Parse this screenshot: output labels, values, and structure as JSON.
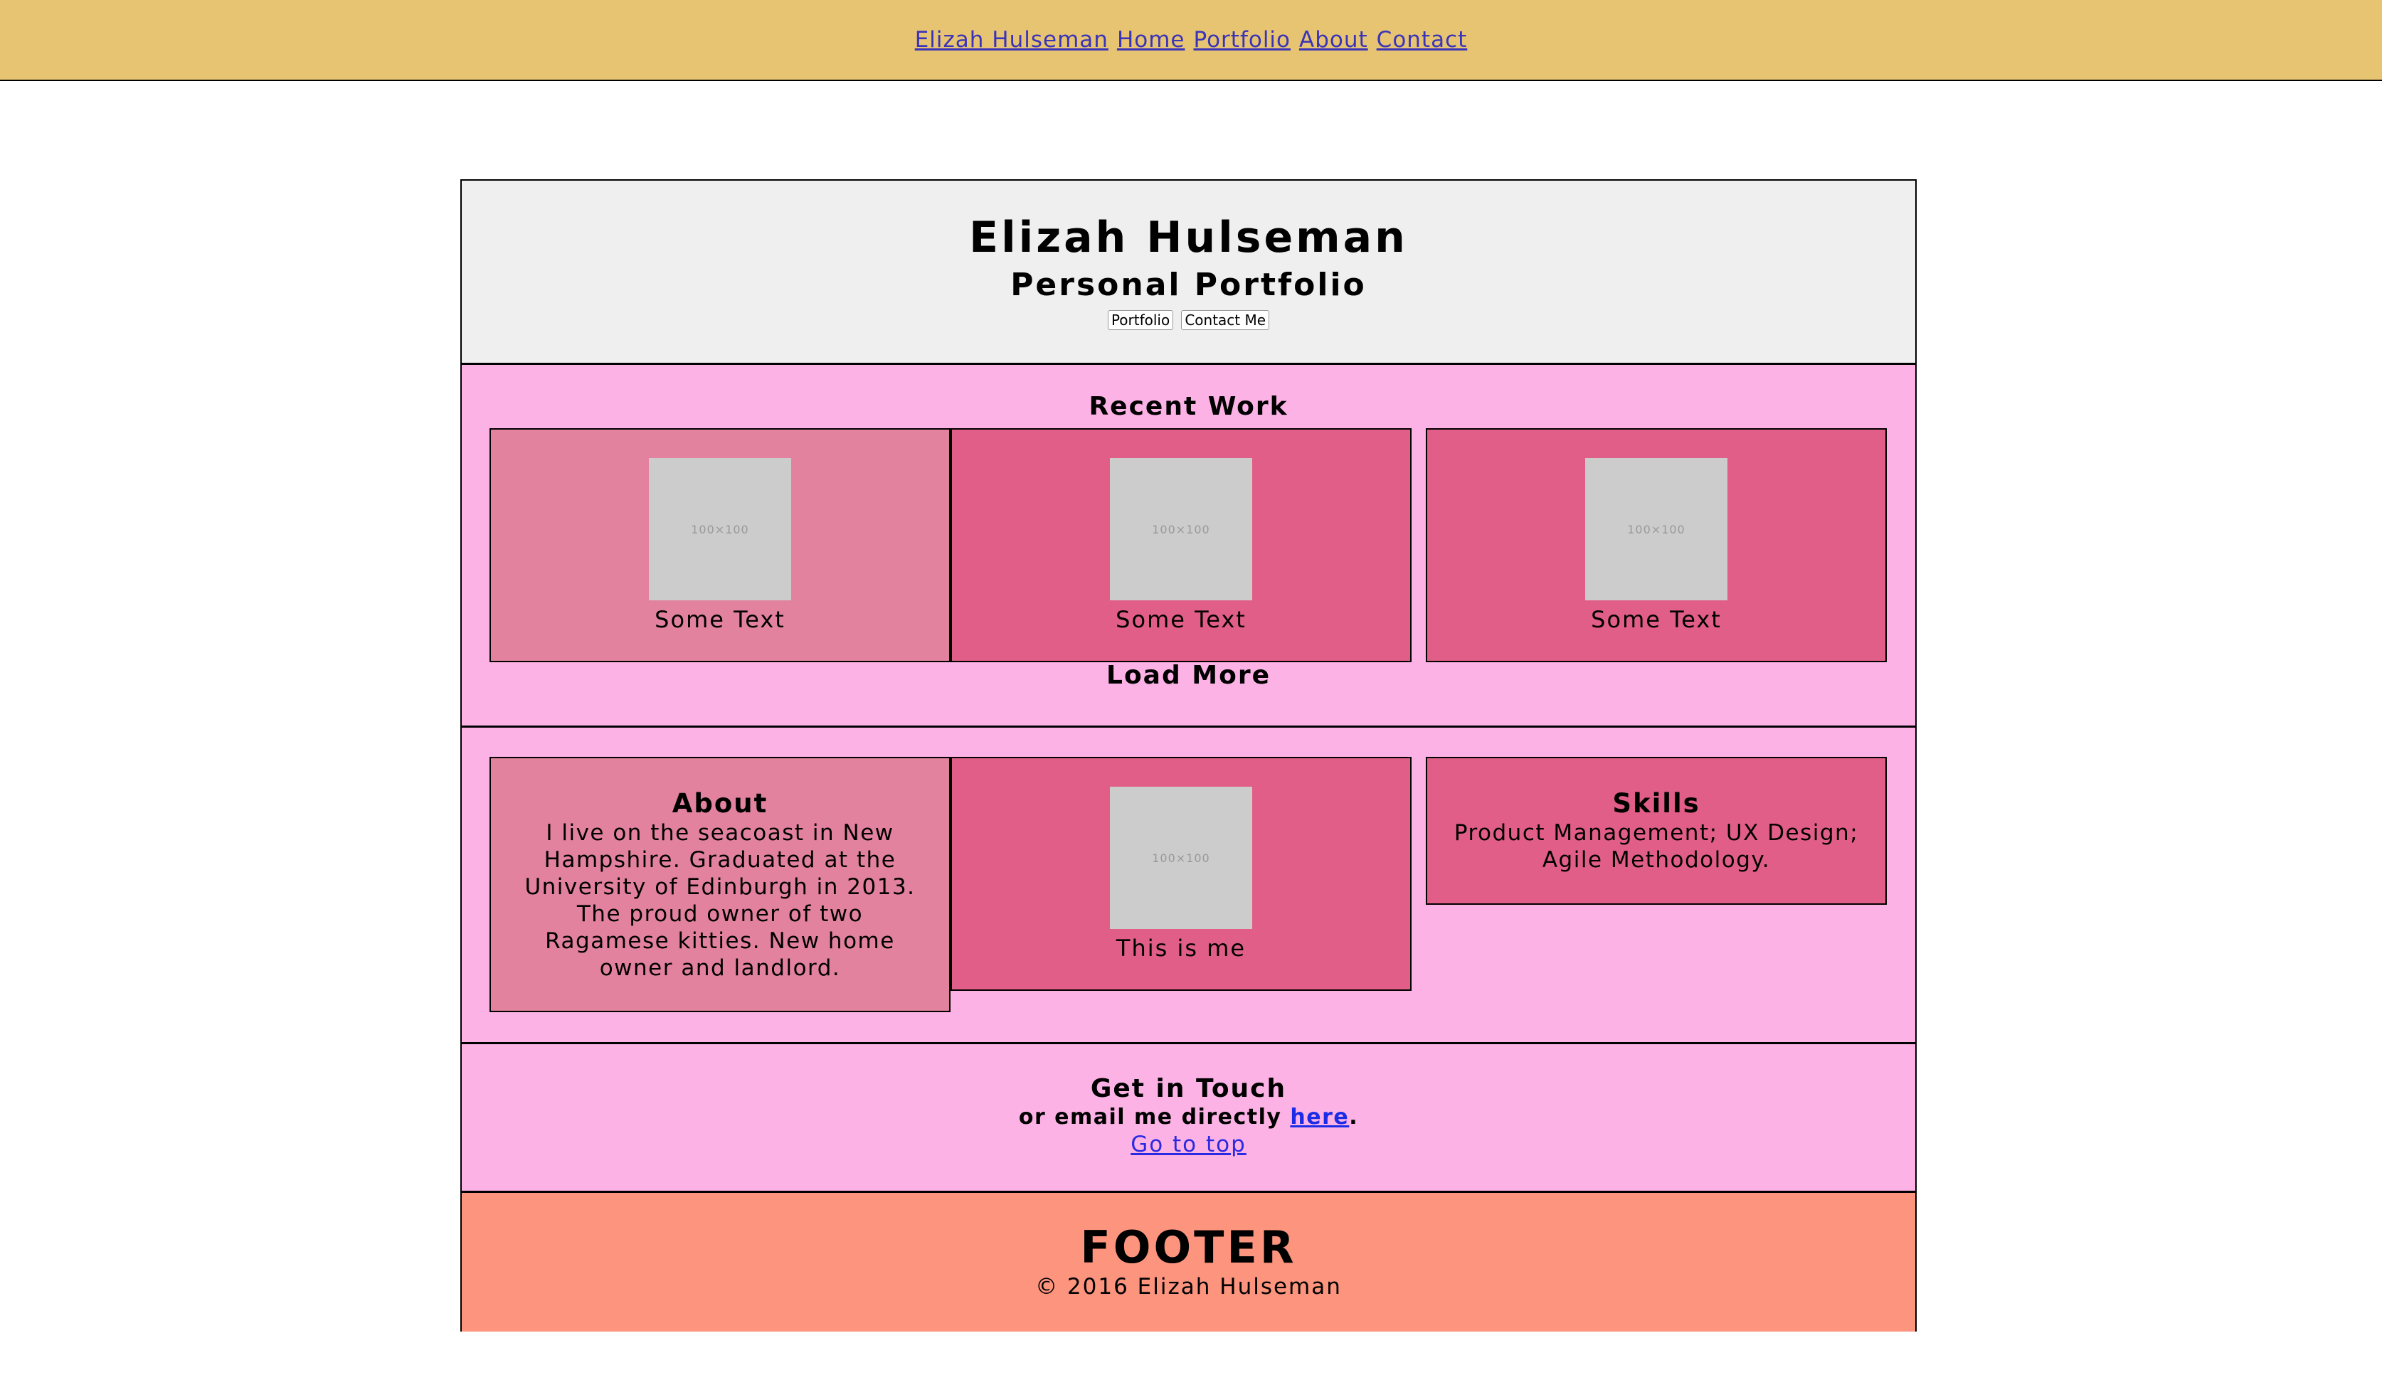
{
  "nav": {
    "brand": "Elizah Hulseman",
    "links": [
      "Home",
      "Portfolio",
      "About",
      "Contact"
    ]
  },
  "hero": {
    "title": "Elizah Hulseman",
    "subtitle": "Personal Portfolio",
    "buttons": [
      "Portfolio",
      "Contact Me"
    ]
  },
  "recent": {
    "title": "Recent Work",
    "placeholder": "100×100",
    "cards": [
      "Some Text",
      "Some Text",
      "Some Text"
    ],
    "load_more": "Load More"
  },
  "about": {
    "title": "About",
    "text": "I live on the seacoast in New Hampshire. Graduated at the University of Edinburgh in 2013. The proud owner of two Ragamese kitties. New home owner and landlord.",
    "photo_caption": "This is me",
    "placeholder": "100×100",
    "skills_title": "Skills",
    "skills_text": "Product Management; UX Design; Agile Methodology."
  },
  "contact": {
    "title": "Get in Touch",
    "email_prefix": "or email me directly ",
    "email_link": "here",
    "email_suffix": ".",
    "top_link": "Go to top"
  },
  "footer": {
    "title": "FOOTER",
    "copyright": "© 2016 Elizah Hulseman"
  },
  "colors": {
    "nav_bg": "#e6c472",
    "section_pink": "#fdb2e6",
    "card_light": "#e2829f",
    "card_dark": "#e15e88",
    "footer_bg": "#fd947e"
  }
}
